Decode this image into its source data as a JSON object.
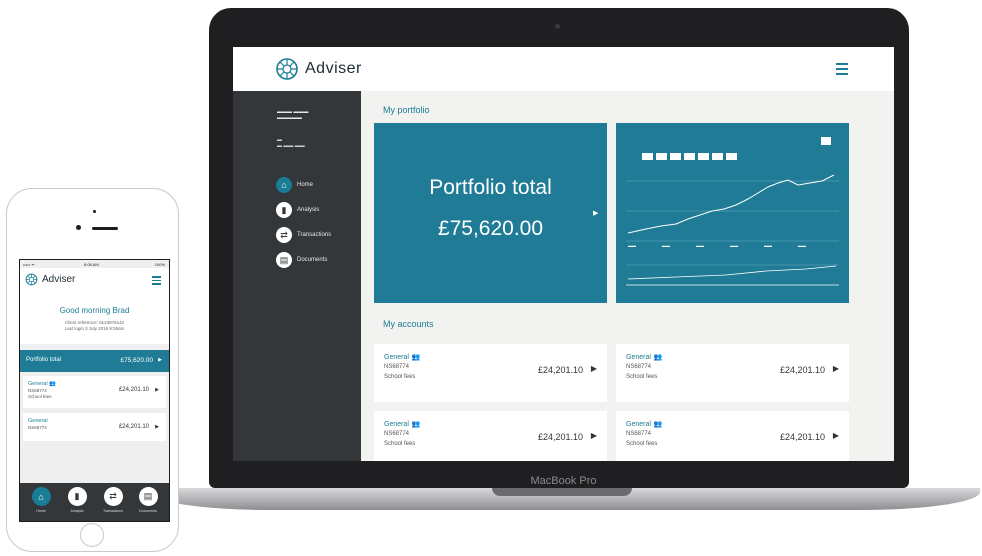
{
  "laptop": {
    "model_label": "MacBook Pro",
    "app": {
      "brand": "Adviser",
      "sidebar": {
        "nav": [
          {
            "icon": "home-icon",
            "label": "Home",
            "active": true
          },
          {
            "icon": "analysis-icon",
            "label": "Analysis",
            "active": false
          },
          {
            "icon": "transactions-icon",
            "label": "Transactions",
            "active": false
          },
          {
            "icon": "documents-icon",
            "label": "Documents",
            "active": false
          }
        ]
      },
      "overview_title": "My portfolio",
      "portfolio_tile": {
        "label": "Portfolio total",
        "value": "£75,620.00"
      },
      "accounts_title": "My accounts",
      "accounts": [
        {
          "name": "General",
          "number": "NS68774",
          "description": "School fees",
          "value": "£24,201.10"
        },
        {
          "name": "General",
          "number": "NS68774",
          "description": "School fees",
          "value": "£24,201.10"
        },
        {
          "name": "General",
          "number": "NS68774",
          "description": "School fees",
          "value": "£24,201.10"
        },
        {
          "name": "General",
          "number": "NS68774",
          "description": "School fees",
          "value": "£24,201.10"
        }
      ]
    }
  },
  "phone": {
    "status": {
      "carrier": "••••• ᯤ",
      "time": "8:08 AM",
      "battery": "100%"
    },
    "brand": "Adviser",
    "greeting": "Good morning Brad",
    "client_reference": "Client reference: 0123976142",
    "last_login": "Last login 3 July 2016 9:56am",
    "portfolio_total": {
      "label": "Portfolio total",
      "value": "£75,620.00"
    },
    "accounts": [
      {
        "name": "General",
        "number": "NS68774",
        "description": "School fees",
        "value": "£24,201.10"
      },
      {
        "name": "General",
        "number": "NS68774",
        "description": "",
        "value": "£24,201.10"
      }
    ],
    "nav": [
      {
        "icon": "home-icon",
        "label": "Home",
        "active": true
      },
      {
        "icon": "analysis-icon",
        "label": "Analysis",
        "active": false
      },
      {
        "icon": "transactions-icon",
        "label": "Transactions",
        "active": false
      },
      {
        "icon": "documents-icon",
        "label": "Documents",
        "active": false
      }
    ]
  },
  "colors": {
    "brand_teal": "#1f7b96",
    "sidebar_dark": "#33373a"
  }
}
